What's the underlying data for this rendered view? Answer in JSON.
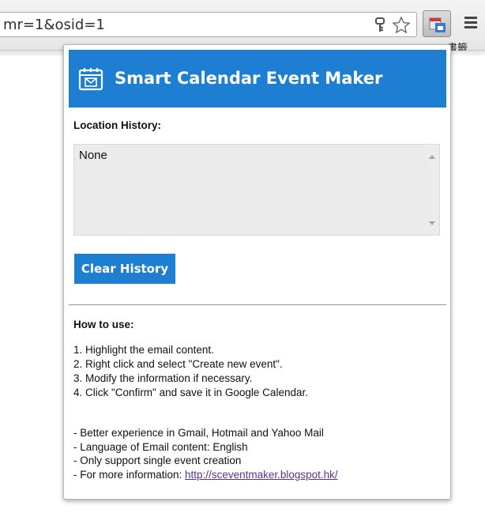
{
  "browser": {
    "url": "mr=1&osid=1",
    "bookmark_text": "書籤",
    "extension_icon": "calendar-icon",
    "menu_icon": "hamburger-icon"
  },
  "popup": {
    "title": "Smart Calendar Event Maker",
    "location_history_label": "Location History:",
    "history_value": "None",
    "clear_button_label": "Clear History",
    "how_to_use_label": "How to use:",
    "steps": [
      "1. Highlight the email content.",
      "2. Right click and select \"Create new event\".",
      "3. Modify the information if necessary.",
      "4. Click \"Confirm\" and save it in Google Calendar."
    ],
    "notes": [
      "- Better experience in Gmail, Hotmail and Yahoo Mail",
      "- Language of Email content: English",
      "- Only support single event creation"
    ],
    "more_info_prefix": "- For more information: ",
    "more_info_link": "http://sceventmaker.blogspot.hk/"
  },
  "colors": {
    "accent": "#1e7fd2",
    "link": "#5b2f9e"
  }
}
